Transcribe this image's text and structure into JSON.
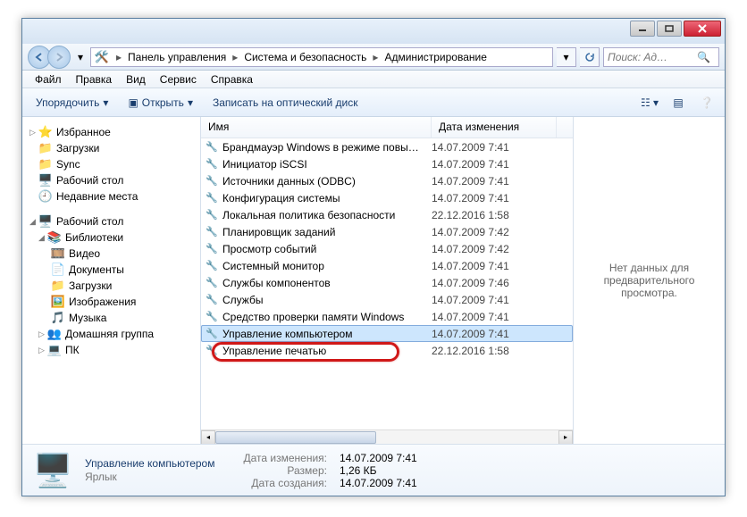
{
  "breadcrumb": [
    "Панель управления",
    "Система и безопасность",
    "Администрирование"
  ],
  "search": {
    "placeholder": "Поиск: Ад…"
  },
  "menubar": [
    "Файл",
    "Правка",
    "Вид",
    "Сервис",
    "Справка"
  ],
  "toolbar": {
    "organize": "Упорядочить",
    "open": "Открыть",
    "burn": "Записать на оптический диск"
  },
  "sidebar": {
    "favorites": {
      "label": "Избранное",
      "items": [
        "Загрузки",
        "Sync",
        "Рабочий стол",
        "Недавние места"
      ]
    },
    "desktop": {
      "label": "Рабочий стол",
      "libraries": {
        "label": "Библиотеки",
        "items": [
          "Видео",
          "Документы",
          "Загрузки",
          "Изображения",
          "Музыка"
        ]
      },
      "homegroup": "Домашняя группа",
      "pc": "ПК"
    }
  },
  "columns": {
    "name": "Имя",
    "date": "Дата изменения"
  },
  "files": [
    {
      "name": "Брандмауэр Windows в режиме повы…",
      "date": "14.07.2009 7:41"
    },
    {
      "name": "Инициатор iSCSI",
      "date": "14.07.2009 7:41"
    },
    {
      "name": "Источники данных (ODBC)",
      "date": "14.07.2009 7:41"
    },
    {
      "name": "Конфигурация системы",
      "date": "14.07.2009 7:41"
    },
    {
      "name": "Локальная политика безопасности",
      "date": "22.12.2016 1:58"
    },
    {
      "name": "Планировщик заданий",
      "date": "14.07.2009 7:42"
    },
    {
      "name": "Просмотр событий",
      "date": "14.07.2009 7:42"
    },
    {
      "name": "Системный монитор",
      "date": "14.07.2009 7:41"
    },
    {
      "name": "Службы компонентов",
      "date": "14.07.2009 7:46"
    },
    {
      "name": "Службы",
      "date": "14.07.2009 7:41"
    },
    {
      "name": "Средство проверки памяти Windows",
      "date": "14.07.2009 7:41"
    },
    {
      "name": "Управление компьютером",
      "date": "14.07.2009 7:41"
    },
    {
      "name": "Управление печатью",
      "date": "22.12.2016 1:58"
    }
  ],
  "selected_index": 11,
  "preview_text": "Нет данных для предварительного просмотра.",
  "details": {
    "title": "Управление компьютером",
    "type": "Ярлык",
    "meta": {
      "modified_label": "Дата изменения:",
      "modified": "14.07.2009 7:41",
      "size_label": "Размер:",
      "size": "1,26 КБ",
      "created_label": "Дата создания:",
      "created": "14.07.2009 7:41"
    }
  }
}
